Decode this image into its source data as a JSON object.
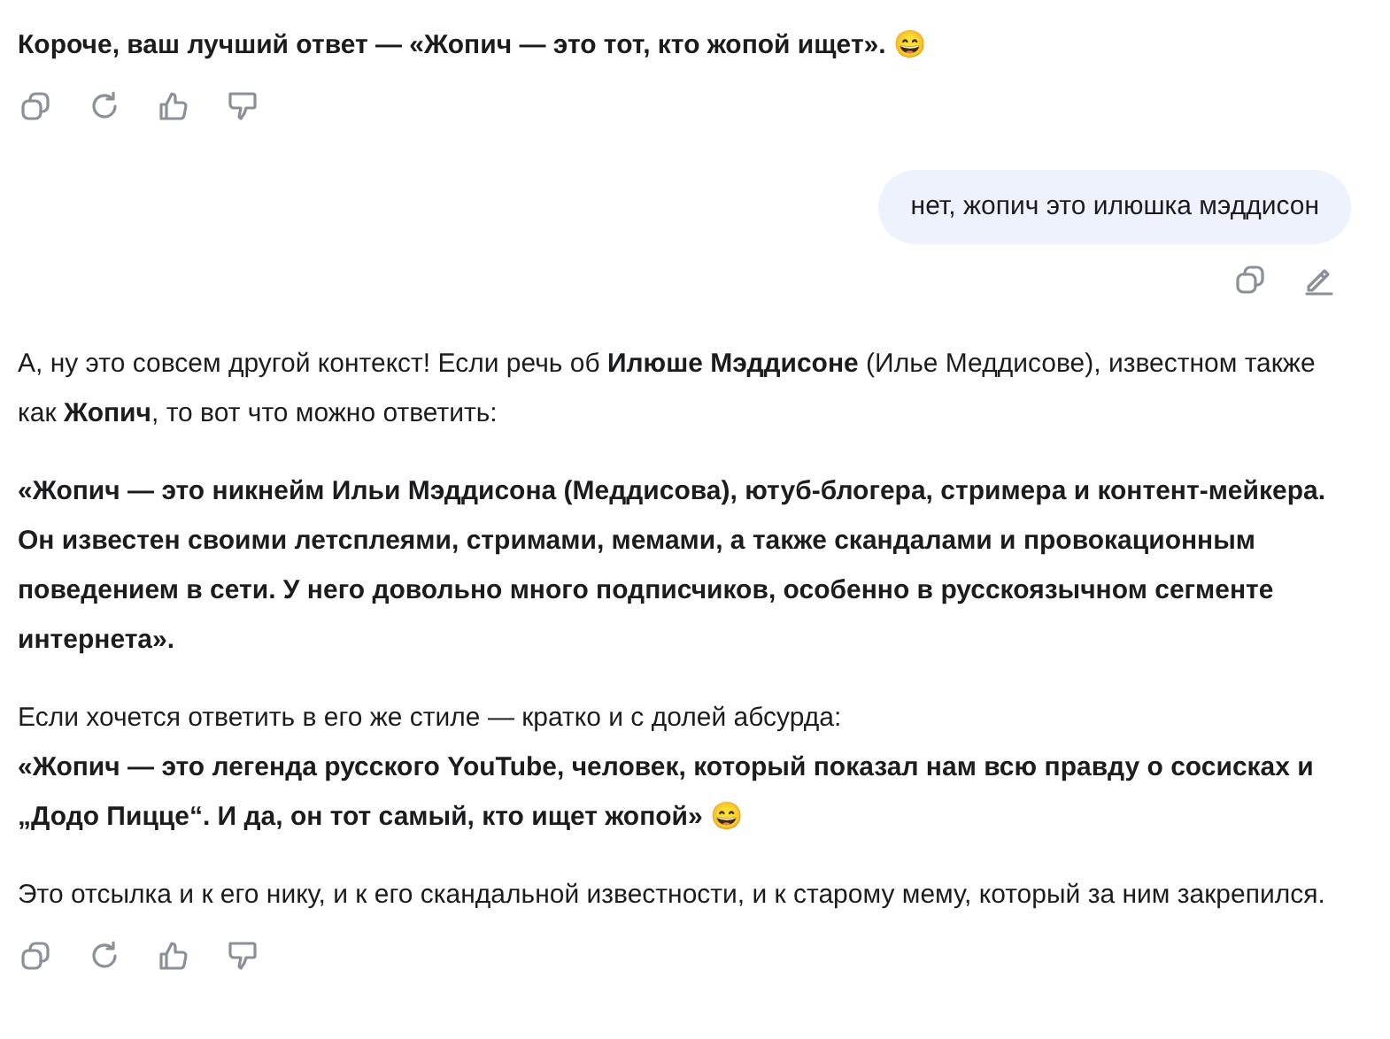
{
  "messages": [
    {
      "kind": "assistant",
      "paragraphs": [
        {
          "text": "Короче, ваш лучший ответ — «Жопич — это тот, кто жопой ищет». 😄",
          "bold": true
        }
      ],
      "actions": [
        {
          "kind": "copy"
        },
        {
          "kind": "regenerate"
        },
        {
          "kind": "like"
        },
        {
          "kind": "dislike"
        }
      ]
    },
    {
      "kind": "user",
      "paragraphs": [
        {
          "text": "нет, жопич это илюшка мэддисон",
          "bold": false
        }
      ],
      "actions": [
        {
          "kind": "copy"
        },
        {
          "kind": "edit"
        }
      ]
    },
    {
      "kind": "assistant",
      "paragraphs": [
        {
          "text": "А, ну это совсем другой контекст! Если речь об **Илюше Мэддисоне** (Илье Меддисове), известном также как **Жопич**, то вот что можно ответить:",
          "bold": false
        },
        {
          "text": "«Жопич — это никнейм Ильи Мэддисона (Меддисова), ютуб-блогера, стримера и контент-мейкера. Он известен своими летсплеями, стримами, мемами, а также скандалами и провокационным поведением в сети. У него довольно много подписчиков, особенно в русскоязычном сегменте интернета».",
          "bold": true
        },
        {
          "text": "Если хочется ответить в его же стиле — кратко и с долей абсурда:\n**«Жопич — это легенда русского YouTube, человек, который показал нам всю правду о сосисках и „Додо Пицце“. И да, он тот самый, кто ищет жопой»** 😄",
          "bold": false
        },
        {
          "text": "Это отсылка и к его нику, и к его скандальной известности, и к старому мему, который за ним закрепился.",
          "bold": false
        }
      ],
      "actions": [
        {
          "kind": "copy"
        },
        {
          "kind": "regenerate"
        },
        {
          "kind": "like"
        },
        {
          "kind": "dislike"
        }
      ]
    }
  ]
}
